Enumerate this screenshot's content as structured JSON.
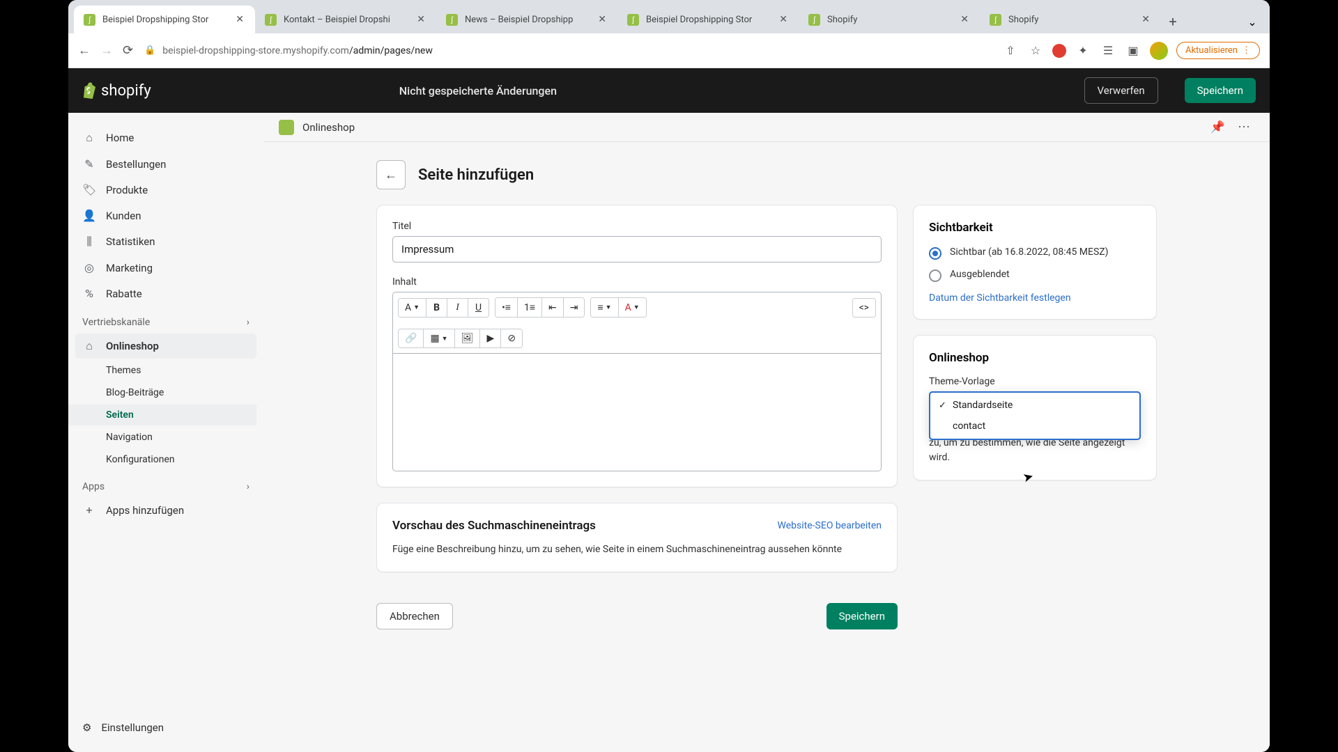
{
  "tabs": [
    {
      "title": "Beispiel Dropshipping Stor",
      "active": true
    },
    {
      "title": "Kontakt – Beispiel Dropshi"
    },
    {
      "title": "News – Beispiel Dropshipp"
    },
    {
      "title": "Beispiel Dropshipping Stor"
    },
    {
      "title": "Shopify"
    },
    {
      "title": "Shopify"
    }
  ],
  "url": {
    "host": "beispiel-dropshipping-store.myshopify.com",
    "path": "/admin/pages/new"
  },
  "update_label": "Aktualisieren",
  "topbar": {
    "unsaved": "Nicht gespeicherte Änderungen",
    "discard": "Verwerfen",
    "save": "Speichern",
    "logo": "shopify"
  },
  "crumb": {
    "label": "Onlineshop"
  },
  "nav": {
    "items": [
      {
        "label": "Home",
        "icon": "⌂"
      },
      {
        "label": "Bestellungen",
        "icon": "✎"
      },
      {
        "label": "Produkte",
        "icon": "🏷"
      },
      {
        "label": "Kunden",
        "icon": "👤"
      },
      {
        "label": "Statistiken",
        "icon": "📊"
      },
      {
        "label": "Marketing",
        "icon": "🎯"
      },
      {
        "label": "Rabatte",
        "icon": "%"
      }
    ],
    "channels_label": "Vertriebskanäle",
    "onlineshop": "Onlineshop",
    "subs": [
      {
        "label": "Themes"
      },
      {
        "label": "Blog-Beiträge"
      },
      {
        "label": "Seiten",
        "active": true
      },
      {
        "label": "Navigation"
      },
      {
        "label": "Konfigurationen"
      }
    ],
    "apps_label": "Apps",
    "add_apps": "Apps hinzufügen",
    "settings": "Einstellungen"
  },
  "page": {
    "title": "Seite hinzufügen",
    "title_label": "Titel",
    "title_value": "Impressum",
    "content_label": "Inhalt",
    "seo": {
      "title": "Vorschau des Suchmaschineneintrags",
      "edit": "Website-SEO bearbeiten",
      "help": "Füge eine Beschreibung hinzu, um zu sehen, wie Seite in einem Suchmaschineneintrag aussehen könnte"
    },
    "cancel": "Abbrechen",
    "save": "Speichern"
  },
  "visibility": {
    "title": "Sichtbarkeit",
    "visible": "Sichtbar (ab 16.8.2022, 08:45 MESZ)",
    "hidden": "Ausgeblendet",
    "set_date": "Datum der Sichtbarkeit festlegen"
  },
  "template": {
    "title": "Onlineshop",
    "label": "Theme-Vorlage",
    "options": [
      "Standardseite",
      "contact"
    ],
    "help": "Weise ein Template aus deinem aktuellen Theme zu, um zu bestimmen, wie die Seite angezeigt wird."
  }
}
